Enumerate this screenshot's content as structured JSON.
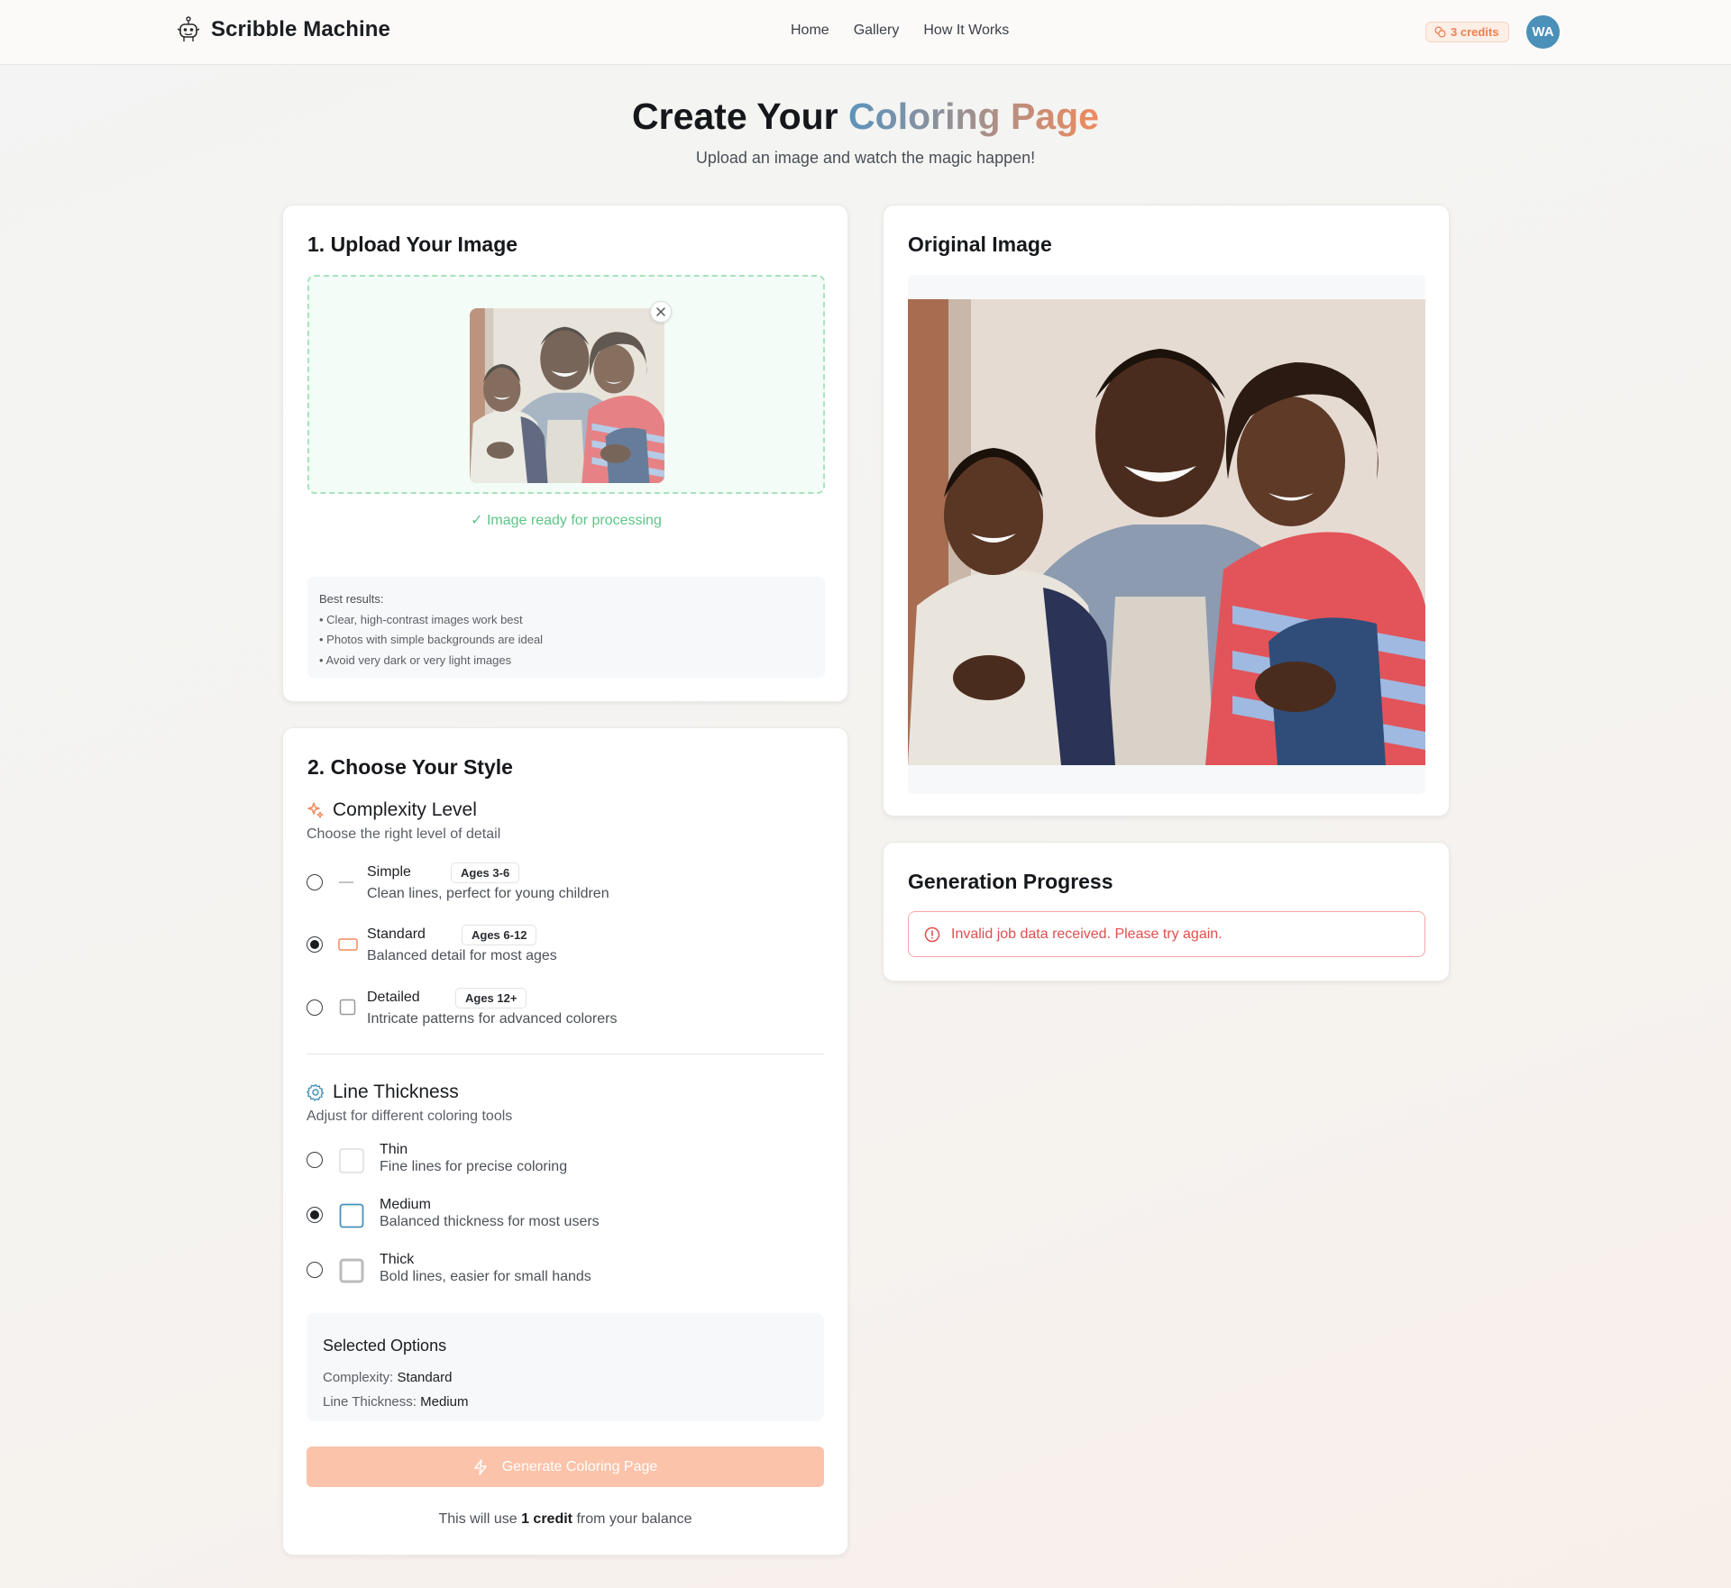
{
  "header": {
    "brand": "Scribble Machine",
    "nav": [
      "Home",
      "Gallery",
      "How It Works"
    ],
    "credits": "3 credits",
    "avatar": "WA"
  },
  "hero": {
    "title_start": "Create Your",
    "title_accent": "Coloring Page",
    "subtitle": "Upload an image and watch the magic happen!"
  },
  "upload": {
    "title": "1. Upload Your Image",
    "status": "✓ Image ready for processing",
    "tips_title": "Best results:",
    "tips": [
      "• Clear, high-contrast images work best",
      "• Photos with simple backgrounds are ideal",
      "• Avoid very dark or very light images"
    ]
  },
  "style": {
    "title": "2. Choose Your Style",
    "complexity": {
      "label": "Complexity Level",
      "subtitle": "Choose the right level of detail",
      "options": [
        {
          "name": "Simple",
          "badge": "Ages 3-6",
          "desc": "Clean lines, perfect for young children",
          "selected": false
        },
        {
          "name": "Standard",
          "badge": "Ages 6-12",
          "desc": "Balanced detail for most ages",
          "selected": true
        },
        {
          "name": "Detailed",
          "badge": "Ages 12+",
          "desc": "Intricate patterns for advanced colorers",
          "selected": false
        }
      ]
    },
    "thickness": {
      "label": "Line Thickness",
      "subtitle": "Adjust for different coloring tools",
      "options": [
        {
          "name": "Thin",
          "desc": "Fine lines for precise coloring",
          "selected": false
        },
        {
          "name": "Medium",
          "desc": "Balanced thickness for most users",
          "selected": true
        },
        {
          "name": "Thick",
          "desc": "Bold lines, easier for small hands",
          "selected": false
        }
      ]
    },
    "selected": {
      "title": "Selected Options",
      "complexity_label": "Complexity:",
      "complexity_value": "Standard",
      "thickness_label": "Line Thickness:",
      "thickness_value": "Medium"
    },
    "generate_label": "Generate Coloring Page",
    "credit_note_pre": "This will use",
    "credit_note_bold": "1 credit",
    "credit_note_post": "from your balance"
  },
  "original": {
    "title": "Original Image"
  },
  "progress": {
    "title": "Generation Progress",
    "error": "Invalid job data received. Please try again."
  },
  "colors": {
    "accent_orange": "#f08a5d",
    "accent_blue": "#4a90b8",
    "success_green": "#5fc487",
    "error_red": "#e04f4f"
  }
}
